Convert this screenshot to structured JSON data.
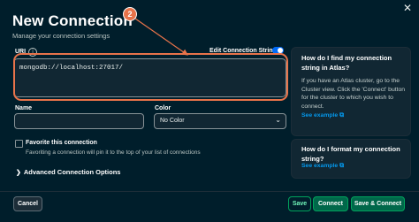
{
  "dialog": {
    "title": "New Connection",
    "subtitle": "Manage your connection settings",
    "close_icon": "close-icon"
  },
  "uri": {
    "label": "URI",
    "info_icon": "i",
    "edit_toggle_label": "Edit Connection String",
    "edit_toggle_on": true,
    "value": "mongodb://localhost:27017/"
  },
  "name": {
    "label": "Name",
    "value": ""
  },
  "color": {
    "label": "Color",
    "selected": "No Color",
    "chevron": "⌄"
  },
  "favorite": {
    "label": "Favorite this connection",
    "description": "Favoriting a connection will pin it to the top of your list of connections",
    "checked": false
  },
  "advanced": {
    "chevron": "❯",
    "label": "Advanced Connection Options"
  },
  "help_cards": [
    {
      "title": "How do I find my connection string in Atlas?",
      "body": "If you have an Atlas cluster, go to the Cluster view. Click the 'Connect' button for the cluster to which you wish to connect.",
      "link": "See example"
    },
    {
      "title": "How do I format my connection string?",
      "link": "See example"
    }
  ],
  "footer": {
    "cancel": "Cancel",
    "save": "Save",
    "connect": "Connect",
    "save_connect": "Save & Connect"
  },
  "annotation": {
    "badge": "2",
    "color": "#e8734a"
  },
  "colors": {
    "background": "#001e2b",
    "accent_green": "#00684a",
    "toggle_blue": "#016bf8",
    "link_blue": "#0498ec"
  }
}
